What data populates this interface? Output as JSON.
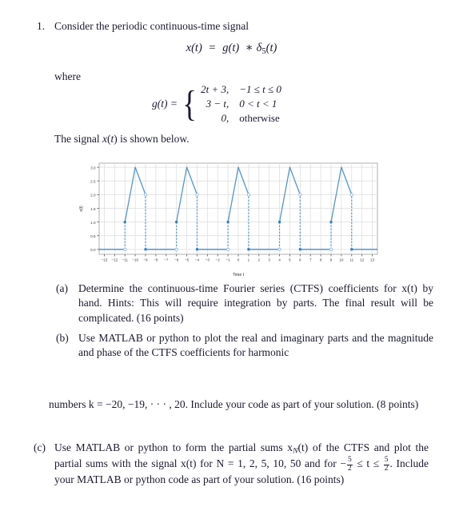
{
  "document": {
    "problem_number": "1.",
    "intro": "Consider the periodic continuous-time signal",
    "main_equation": {
      "lhs": "x(t)",
      "eq": "=",
      "rhs_g": "g(t)",
      "op": "∗",
      "rhs_delta": "δ",
      "delta_sub": "5",
      "delta_arg": "(t)"
    },
    "where_label": "where",
    "piecewise": {
      "lhs": "g(t) =",
      "rows": [
        {
          "value": "2t + 3,",
          "condition": "−1 ≤ t ≤ 0"
        },
        {
          "value": "3 − t,",
          "condition": "0 < t < 1"
        },
        {
          "value": "0,",
          "condition": "otherwise"
        }
      ]
    },
    "signal_caption": "The signal x(t) is shown below.",
    "parts": [
      {
        "label": "(a)",
        "text": "Determine the continuous-time Fourier series (CTFS) coefficients for x(t) by hand. Hints: This will require integration by parts. The final result will be complicated. (16 points)"
      },
      {
        "label": "(b)",
        "text": "Use MATLAB or python to plot the real and imaginary parts and the magnitude and phase of the CTFS coefficients for harmonic"
      }
    ],
    "part_b_continued": "numbers k = −20, −19, · · · , 20. Include your code as part of your solution. (8 points)",
    "part_c": {
      "label": "(c)",
      "text_1": "Use MATLAB or python to form the partial sums x",
      "sub_N": "N",
      "text_2": "(t) of the CTFS and plot the partial sums with the signal x(t) for N = 1, 2, 5, 10, 50 and for −",
      "frac1_num": "5",
      "frac1_den": "2",
      "text_3": " ≤ t ≤ ",
      "frac2_num": "5",
      "frac2_den": "2",
      "text_4": ". Include your MATLAB or python code as part of your solution. (16 points)"
    }
  },
  "chart_data": {
    "type": "line",
    "title": "",
    "xlabel": "Time t",
    "ylabel": "x(t)",
    "xlim": [
      -13.5,
      13.5
    ],
    "ylim": [
      -0.18,
      3.15
    ],
    "xticks": [
      -13,
      -12,
      -11,
      -10,
      -9,
      -8,
      -7,
      -6,
      -5,
      -4,
      -3,
      -2,
      -1,
      0,
      1,
      2,
      3,
      4,
      5,
      6,
      7,
      8,
      9,
      10,
      11,
      12,
      13
    ],
    "yticks": [
      0.0,
      0.5,
      1.0,
      1.5,
      2.0,
      2.5,
      3.0
    ],
    "ytick_labels": [
      "0.0",
      "0.5",
      "1.0",
      "1.5",
      "2.0",
      "2.5",
      "3.0"
    ],
    "grid": true,
    "legend": null,
    "line_color": "#5596cc",
    "baseline_color": "#2f7fbf",
    "period": 5,
    "description": "Periodic triangular pulse train with period 5; each period ramps from 1 at t=5k-1 up to 3 at t=5k, then down to 2 at t=5k+1, with jump discontinuities to 0.",
    "pulse_starts": [
      -11,
      -6,
      -1,
      4,
      9
    ],
    "series": [
      {
        "name": "x(t)",
        "segments": [
          {
            "type": "zero",
            "x": [
              -13.5,
              -11
            ],
            "y": 0
          },
          {
            "type": "ramp",
            "x": [
              -11,
              -10
            ],
            "y": [
              1,
              3
            ]
          },
          {
            "type": "ramp",
            "x": [
              -10,
              -9
            ],
            "y": [
              3,
              2
            ]
          },
          {
            "type": "zero",
            "x": [
              -9,
              -6
            ],
            "y": 0
          },
          {
            "type": "ramp",
            "x": [
              -6,
              -5
            ],
            "y": [
              1,
              3
            ]
          },
          {
            "type": "ramp",
            "x": [
              -5,
              -4
            ],
            "y": [
              3,
              2
            ]
          },
          {
            "type": "zero",
            "x": [
              -4,
              -1
            ],
            "y": 0
          },
          {
            "type": "ramp",
            "x": [
              -1,
              0
            ],
            "y": [
              1,
              3
            ]
          },
          {
            "type": "ramp",
            "x": [
              0,
              1
            ],
            "y": [
              3,
              2
            ]
          },
          {
            "type": "zero",
            "x": [
              1,
              4
            ],
            "y": 0
          },
          {
            "type": "ramp",
            "x": [
              4,
              5
            ],
            "y": [
              1,
              3
            ]
          },
          {
            "type": "ramp",
            "x": [
              5,
              6
            ],
            "y": [
              3,
              2
            ]
          },
          {
            "type": "zero",
            "x": [
              6,
              9
            ],
            "y": 0
          },
          {
            "type": "ramp",
            "x": [
              9,
              10
            ],
            "y": [
              1,
              3
            ]
          },
          {
            "type": "ramp",
            "x": [
              10,
              11
            ],
            "y": [
              3,
              2
            ]
          },
          {
            "type": "zero",
            "x": [
              11,
              13.5
            ],
            "y": 0
          }
        ]
      }
    ],
    "filled_markers": [
      {
        "x": -11,
        "y": 1
      },
      {
        "x": -9,
        "y": 0
      },
      {
        "x": -6,
        "y": 1
      },
      {
        "x": -4,
        "y": 0
      },
      {
        "x": -1,
        "y": 1
      },
      {
        "x": 1,
        "y": 0
      },
      {
        "x": 4,
        "y": 1
      },
      {
        "x": 6,
        "y": 0
      },
      {
        "x": 9,
        "y": 1
      },
      {
        "x": 11,
        "y": 0
      }
    ],
    "open_markers": [
      {
        "x": -11,
        "y": 0
      },
      {
        "x": -9,
        "y": 2
      },
      {
        "x": -6,
        "y": 0
      },
      {
        "x": -4,
        "y": 2
      },
      {
        "x": -1,
        "y": 0
      },
      {
        "x": 1,
        "y": 2
      },
      {
        "x": 4,
        "y": 0
      },
      {
        "x": 6,
        "y": 2
      },
      {
        "x": 9,
        "y": 0
      },
      {
        "x": 11,
        "y": 2
      }
    ],
    "dashed_connectors": [
      {
        "x": -11,
        "y0": 0,
        "y1": 1
      },
      {
        "x": -9,
        "y0": 0,
        "y1": 2
      },
      {
        "x": -6,
        "y0": 0,
        "y1": 1
      },
      {
        "x": -4,
        "y0": 0,
        "y1": 2
      },
      {
        "x": -1,
        "y0": 0,
        "y1": 1
      },
      {
        "x": 1,
        "y0": 0,
        "y1": 2
      },
      {
        "x": 4,
        "y0": 0,
        "y1": 1
      },
      {
        "x": 6,
        "y0": 0,
        "y1": 2
      },
      {
        "x": 9,
        "y0": 0,
        "y1": 1
      },
      {
        "x": 11,
        "y0": 0,
        "y1": 2
      }
    ]
  }
}
